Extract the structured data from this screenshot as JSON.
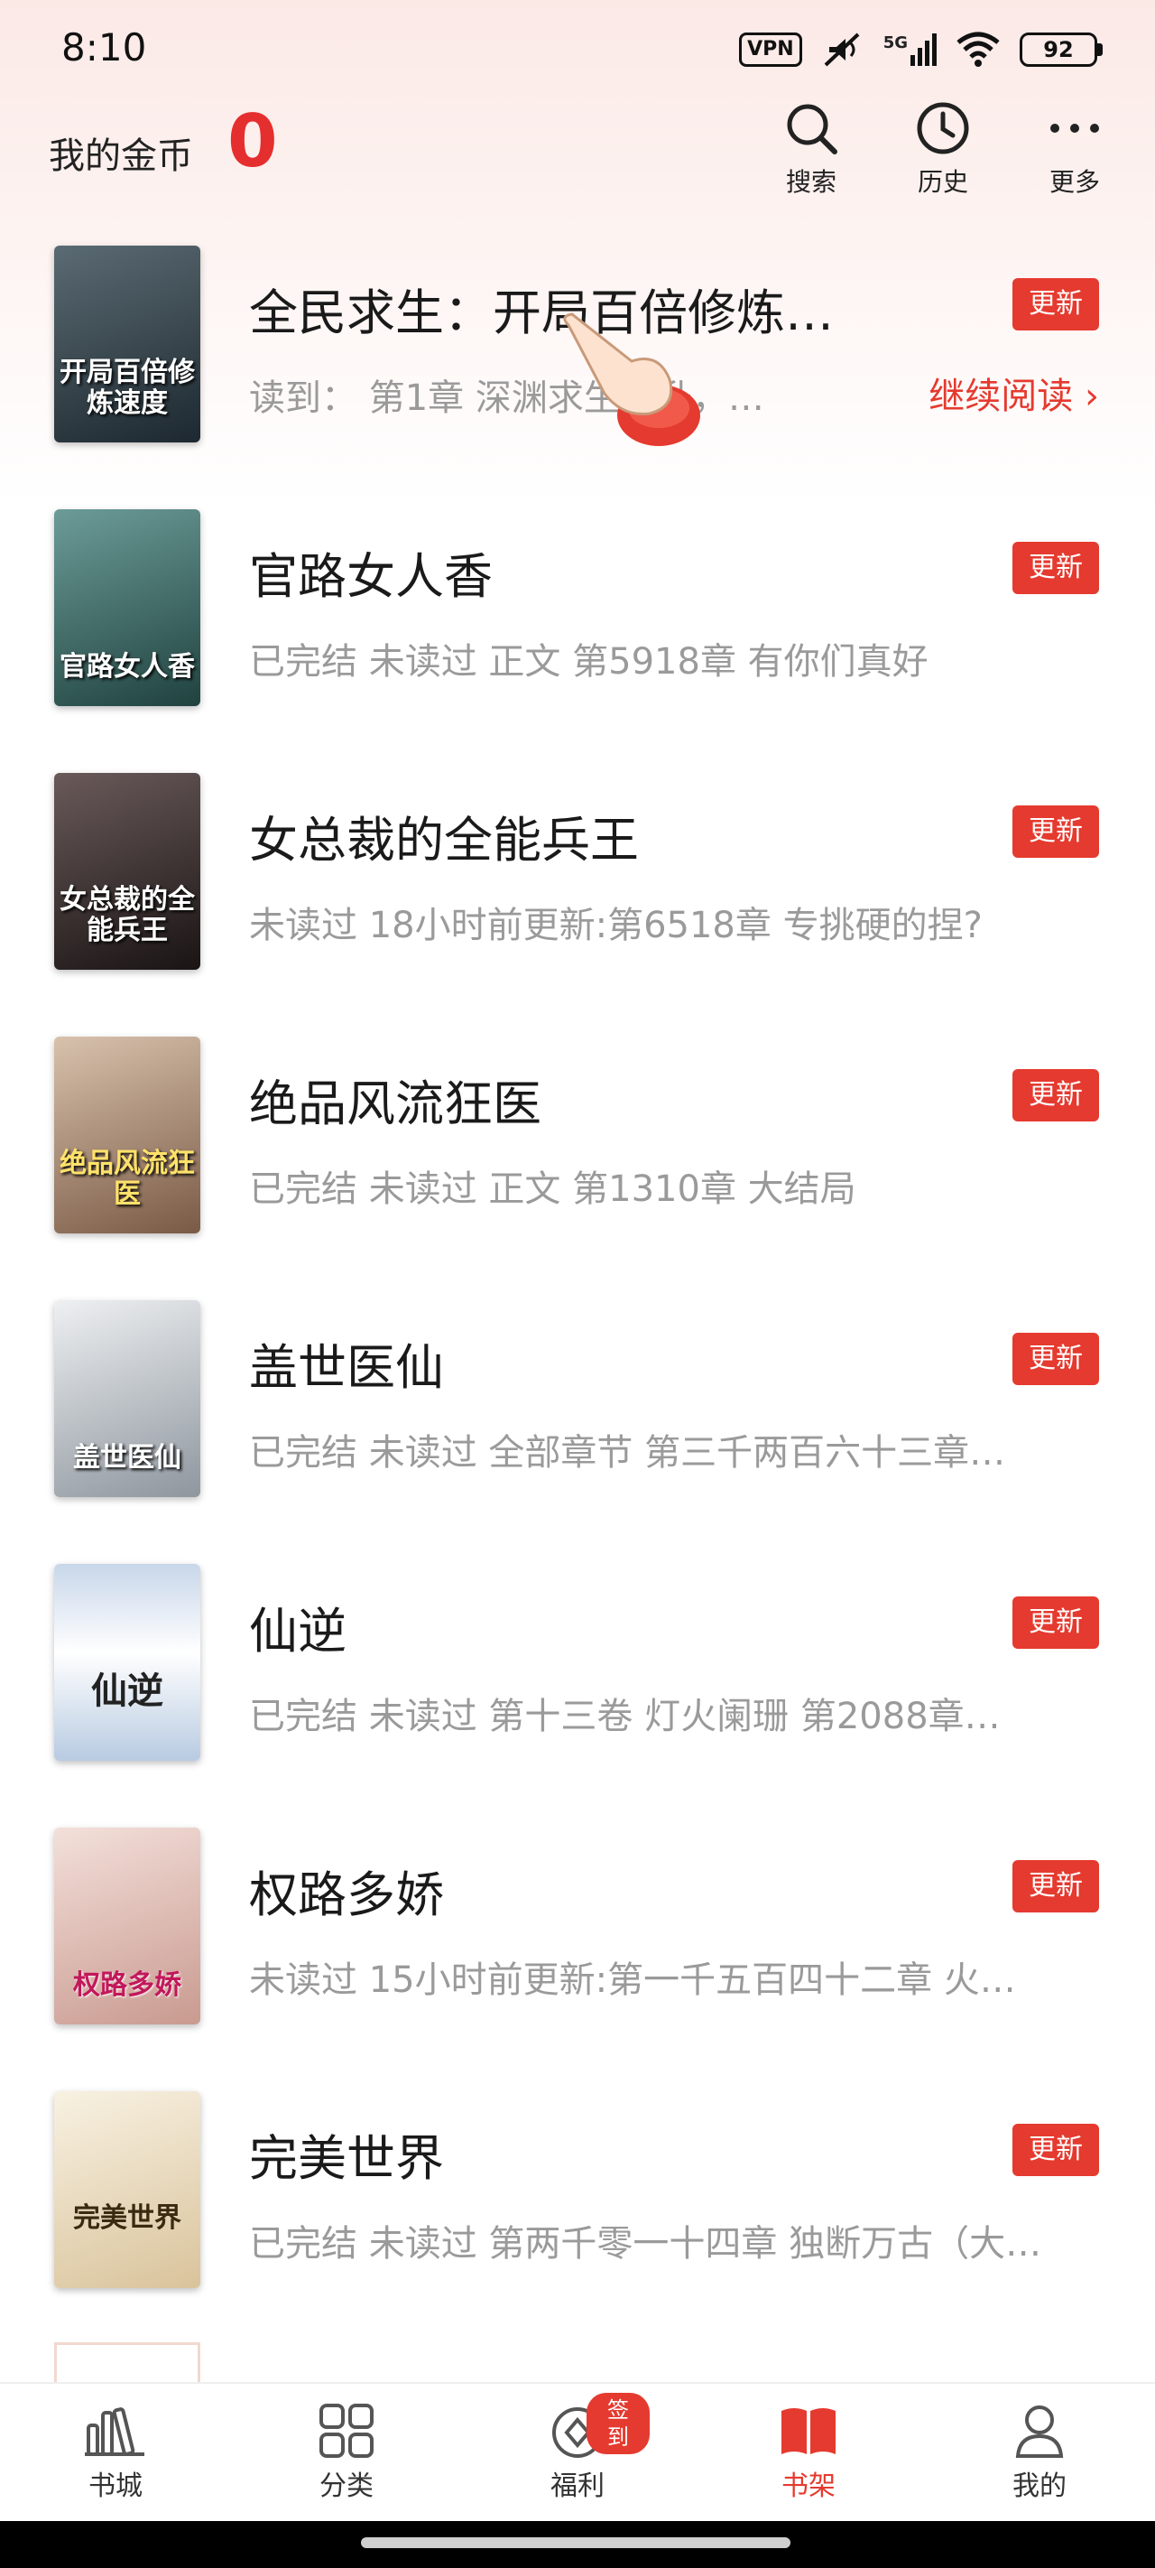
{
  "status_bar": {
    "time": "8:10",
    "vpn": "VPN",
    "network": "5G",
    "battery": "92"
  },
  "header": {
    "coins_label": "我的金币",
    "coins_value": "0",
    "actions": [
      {
        "label": "搜索",
        "icon": "search-icon"
      },
      {
        "label": "历史",
        "icon": "clock-icon"
      },
      {
        "label": "更多",
        "icon": "more-icon"
      }
    ]
  },
  "books": [
    {
      "title": "全民求生：开局百倍修炼…",
      "subtitle": "读到： 第1章 深渊求生榜升，…",
      "badge": "更新",
      "continue": "继续阅读 ›",
      "cover_text": "开局百倍修炼速度",
      "cover_color": "#2b3a44"
    },
    {
      "title": "官路女人香",
      "subtitle": "已完结 未读过 正文 第5918章 有你们真好",
      "badge": "更新",
      "cover_text": "官路女人香",
      "cover_color": "#3c6b6a"
    },
    {
      "title": "女总裁的全能兵王",
      "subtitle": "未读过 18小时前更新:第6518章 专挑硬的捏?",
      "badge": "更新",
      "cover_text": "女总裁的全能兵王",
      "cover_color": "#3a3232"
    },
    {
      "title": "绝品风流狂医",
      "subtitle": "已完结 未读过 正文 第1310章 大结局",
      "badge": "更新",
      "cover_text": "绝品风流狂医",
      "cover_color": "#a8856a"
    },
    {
      "title": "盖世医仙",
      "subtitle": "已完结 未读过 全部章节 第三千两百六十三章…",
      "badge": "更新",
      "cover_text": "盖世医仙",
      "cover_color": "#c9ced3"
    },
    {
      "title": "仙逆",
      "subtitle": "已完结 未读过 第十三卷 灯火阑珊 第2088章…",
      "badge": "更新",
      "cover_text": "仙逆",
      "cover_color": "#dfe8f2"
    },
    {
      "title": "权路多娇",
      "subtitle": "未读过 15小时前更新:第一千五百四十二章  火…",
      "badge": "更新",
      "cover_text": "权路多娇",
      "cover_color": "#e6c9c2"
    },
    {
      "title": "完美世界",
      "subtitle": "已完结 未读过 第两千零一十四章 独断万古（大…",
      "badge": "更新",
      "cover_text": "完美世界",
      "cover_color": "#efe4cf"
    }
  ],
  "bottom_nav": {
    "items": [
      {
        "label": "书城",
        "icon": "bookstore-icon"
      },
      {
        "label": "分类",
        "icon": "category-grid-icon"
      },
      {
        "label": "福利",
        "icon": "coin-icon",
        "badge": "签到"
      },
      {
        "label": "书架",
        "icon": "bookshelf-icon",
        "active": true
      },
      {
        "label": "我的",
        "icon": "profile-icon"
      }
    ]
  },
  "colors": {
    "accent": "#e53a2f",
    "coins": "#e52e2e"
  }
}
